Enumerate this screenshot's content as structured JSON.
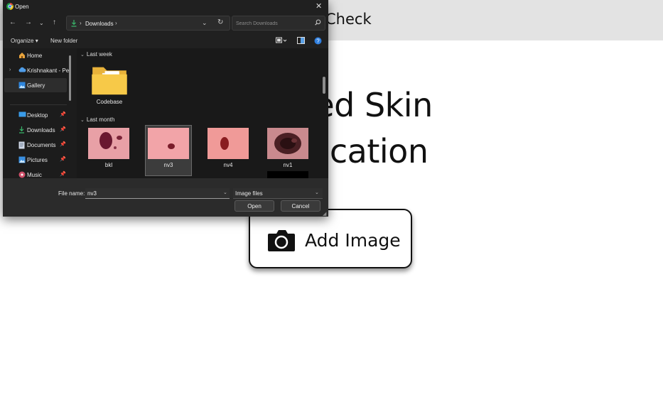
{
  "page": {
    "app_title": "Check",
    "hero_line1": "wered Skin",
    "hero_line2": "assification",
    "add_button_label": "Add Image",
    "camera_icon": "camera-icon"
  },
  "dialog": {
    "title": "Open",
    "address_path": "Downloads",
    "search_placeholder": "Search Downloads",
    "toolbar": {
      "organize": "Organize",
      "new_folder": "New folder"
    },
    "sidebar": [
      {
        "label": "Home",
        "icon": "home-icon",
        "pinned": false
      },
      {
        "label": "Krishnakant - Pe",
        "icon": "cloud-icon",
        "pinned": false
      },
      {
        "label": "Gallery",
        "icon": "gallery-icon",
        "pinned": false,
        "selected": true
      },
      {
        "label": "Desktop",
        "icon": "desktop-icon",
        "pinned": true
      },
      {
        "label": "Downloads",
        "icon": "download-icon",
        "pinned": true
      },
      {
        "label": "Documents",
        "icon": "documents-icon",
        "pinned": true
      },
      {
        "label": "Pictures",
        "icon": "pictures-icon",
        "pinned": true
      },
      {
        "label": "Music",
        "icon": "music-icon",
        "pinned": true
      }
    ],
    "groups": [
      {
        "title": "Last week",
        "items": [
          {
            "name": "Codebase",
            "type": "folder"
          }
        ]
      },
      {
        "title": "Last month",
        "items": [
          {
            "name": "bkl",
            "type": "image"
          },
          {
            "name": "nv3",
            "type": "image",
            "selected": true
          },
          {
            "name": "nv4",
            "type": "image"
          },
          {
            "name": "nv1",
            "type": "image"
          }
        ]
      }
    ],
    "file_name_label": "File name:",
    "file_name_value": "nv3",
    "file_type": "Image files",
    "open_button": "Open",
    "cancel_button": "Cancel"
  }
}
